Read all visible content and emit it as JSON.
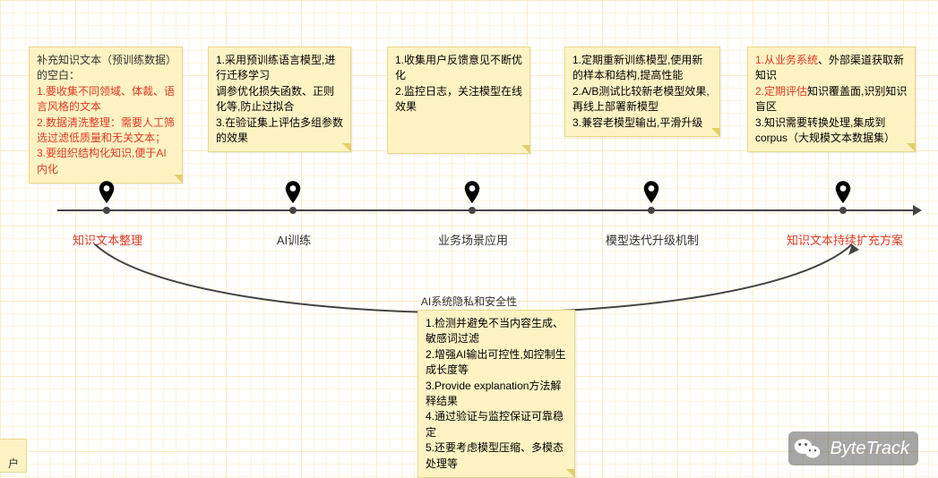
{
  "cards": {
    "c1": {
      "header": "补充知识文本（预训练数据）的空白：",
      "l1": "1.要收集不同领域、体裁、语言风格的文本",
      "l2": "2.数据清洗整理：需要人工筛选过滤低质量和无关文本；",
      "l3": "3.要组织结构化知识,便于AI内化"
    },
    "c2": {
      "l1": "1.采用预训练语言模型,进行迁移学习",
      "l2": "调参优化损失函数、正则化等,防止过拟合",
      "l3": "3.在验证集上评估多组参数的效果"
    },
    "c3": {
      "l1": "1.收集用户反馈意见不断优化",
      "l2": "2.监控日志，关注模型在线效果"
    },
    "c4": {
      "l1": "1.定期重新训练模型,使用新的样本和结构,提高性能",
      "l2": "2.A/B测试比较新老模型效果,再线上部署新模型",
      "l3": "3.兼容老模型输出,平滑升级"
    },
    "c5": {
      "l1a": "1.从业务系统",
      "l1b": "、外部渠道获取新知识",
      "l2a": "2.定期评估",
      "l2b": "知识覆盖面,识别知识盲区",
      "l3": "3.知识需要转换处理,集成到corpus（大规模文本数据集）"
    },
    "c6": {
      "l1": "1.检测并避免不当内容生成、敏感词过滤",
      "l2": "2.增强AI输出可控性,如控制生成长度等",
      "l3": "3.Provide explanation方法解释结果",
      "l4": "4.通过验证与监控保证可靠稳定",
      "l5": "5.还要考虑模型压缩、多模态处理等"
    }
  },
  "stages": {
    "s1": "知识文本整理",
    "s2": "AI训练",
    "s3": "业务场景应用",
    "s4": "模型迭代升级机制",
    "s5": "知识文本持续扩充方案"
  },
  "arc_label": "AI系统隐私和安全性",
  "partial": "户",
  "watermark": "ByteTrack"
}
